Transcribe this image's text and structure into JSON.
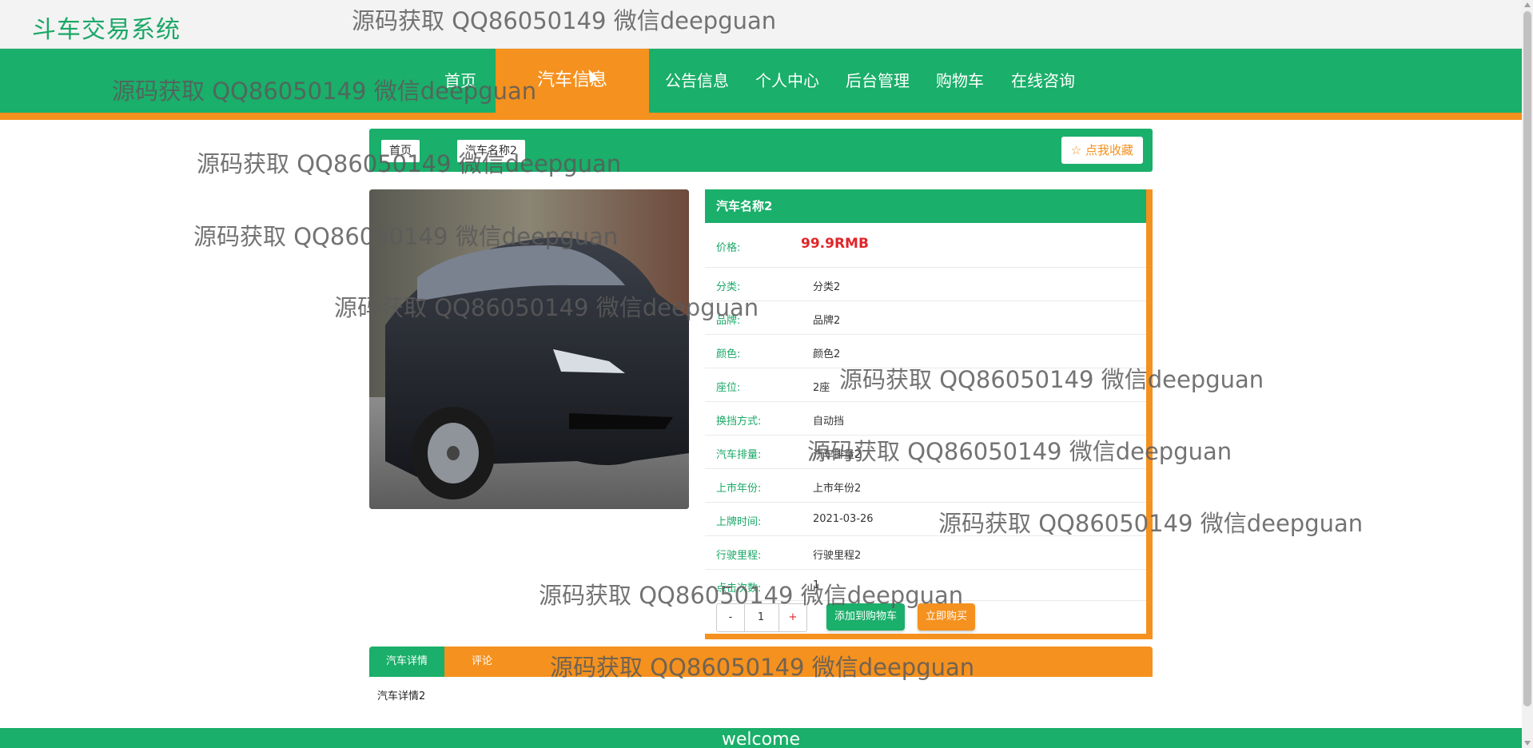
{
  "site": {
    "title": "斗车交易系统"
  },
  "nav": {
    "items": [
      {
        "label": "首页"
      },
      {
        "label": "汽车信息"
      },
      {
        "label": "公告信息"
      },
      {
        "label": "个人中心"
      },
      {
        "label": "后台管理"
      },
      {
        "label": "购物车"
      },
      {
        "label": "在线咨询"
      }
    ]
  },
  "breadcrumb": {
    "home": "首页",
    "current": "汽车名称2"
  },
  "favorite": {
    "label": "☆ 点我收藏"
  },
  "product": {
    "name": "汽车名称2",
    "price_label": "价格:",
    "price": "99.9RMB",
    "fields": [
      {
        "label": "分类:",
        "value": "分类2"
      },
      {
        "label": "品牌:",
        "value": "品牌2"
      },
      {
        "label": "颜色:",
        "value": "颜色2"
      },
      {
        "label": "座位:",
        "value": "2座"
      },
      {
        "label": "换挡方式:",
        "value": "自动挡"
      },
      {
        "label": "汽车排量:",
        "value": "汽车排量2"
      },
      {
        "label": "上市年份:",
        "value": "上市年份2"
      },
      {
        "label": "上牌时间:",
        "value": "2021-03-26"
      },
      {
        "label": "行驶里程:",
        "value": "行驶里程2"
      },
      {
        "label": "点击次数:",
        "value": "1"
      }
    ]
  },
  "quantity": {
    "minus": "-",
    "value": "1",
    "plus": "+"
  },
  "actions": {
    "add_to_cart": "添加到购物车",
    "buy_now": "立即购买"
  },
  "tabs": [
    {
      "label": "汽车详情"
    },
    {
      "label": "评论"
    }
  ],
  "detail": {
    "text": "汽车详情2"
  },
  "footer": {
    "text": "welcome"
  },
  "watermark": {
    "text": "源码获取 QQ86050149 微信deepguan"
  },
  "colors": {
    "primary": "#1aaf6a",
    "accent": "#f5911e",
    "price": "#e0262a"
  }
}
